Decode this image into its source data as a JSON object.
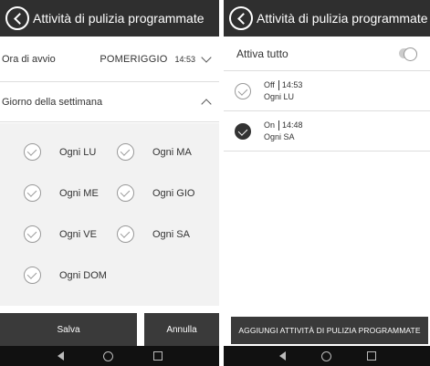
{
  "left": {
    "title": "Attività di pulizia programmate",
    "start": {
      "label": "Ora di avvio",
      "period": "POMERIGGIO",
      "time": "14:53"
    },
    "weekday": {
      "label": "Giorno della settimana"
    },
    "days": [
      "Ogni LU",
      "Ogni MA",
      "Ogni ME",
      "Ogni GIO",
      "Ogni VE",
      "Ogni SA",
      "Ogni DOM"
    ],
    "save_label": "Salva",
    "cancel_label": "Annulla"
  },
  "right": {
    "title": "Attività di pulizia programmate",
    "enable_all_label": "Attiva tutto",
    "tasks": [
      {
        "state": "Off",
        "time": "14:53",
        "day": "Ogni LU",
        "checked": false
      },
      {
        "state": "On",
        "time": "14:48",
        "day": "Ogni SA",
        "checked": true
      }
    ],
    "add_label": "AGGIUNGI ATTIVITÀ DI PULIZIA PROGRAMMATE"
  },
  "icons": [
    "back-circle-icon",
    "chevron-down-icon",
    "chevron-up-icon",
    "check-circle-icon",
    "toggle-switch",
    "nav-back-icon",
    "nav-home-icon",
    "nav-recent-icon"
  ]
}
